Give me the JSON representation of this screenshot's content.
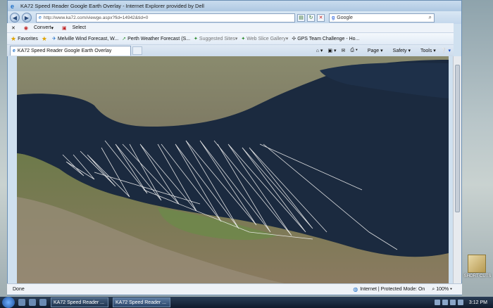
{
  "window": {
    "title": "KA72 Speed Reader Google Earth Overlay - Internet Explorer provided by Dell"
  },
  "address": {
    "url": "http://www.ka72.com/viewge.aspx?fid=14942&tid=0",
    "search_engine": "Google",
    "search_placeholder": "Google"
  },
  "cmdbar": {
    "close": "✕",
    "convert_label": "Convert",
    "select_label": "Select"
  },
  "favorites": {
    "label": "Favorites",
    "items": [
      {
        "label": "Melville Wind Forecast, W..."
      },
      {
        "label": "Perth Weather Forecast (S..."
      },
      {
        "label": "Suggested Sites"
      },
      {
        "label": "Web Slice Gallery"
      },
      {
        "label": "GPS Team Challenge - Ho..."
      }
    ]
  },
  "tab": {
    "label": "KA72 Speed Reader Google Earth Overlay"
  },
  "tools": {
    "page": "Page",
    "safety": "Safety",
    "tools": "Tools"
  },
  "status": {
    "left": "Done",
    "zone": "Internet | Protected Mode: On",
    "zoom": "100%"
  },
  "taskbar": {
    "tasks": [
      {
        "label": "KA72 Speed Reader ..."
      },
      {
        "label": "KA72 Speed Reader ..."
      }
    ],
    "clock": "3:12 PM"
  },
  "desktop": {
    "shortcut_label": "SHORT CUTS"
  },
  "colors": {
    "water": "#1b2a3f",
    "track": "#f2f2f2"
  }
}
